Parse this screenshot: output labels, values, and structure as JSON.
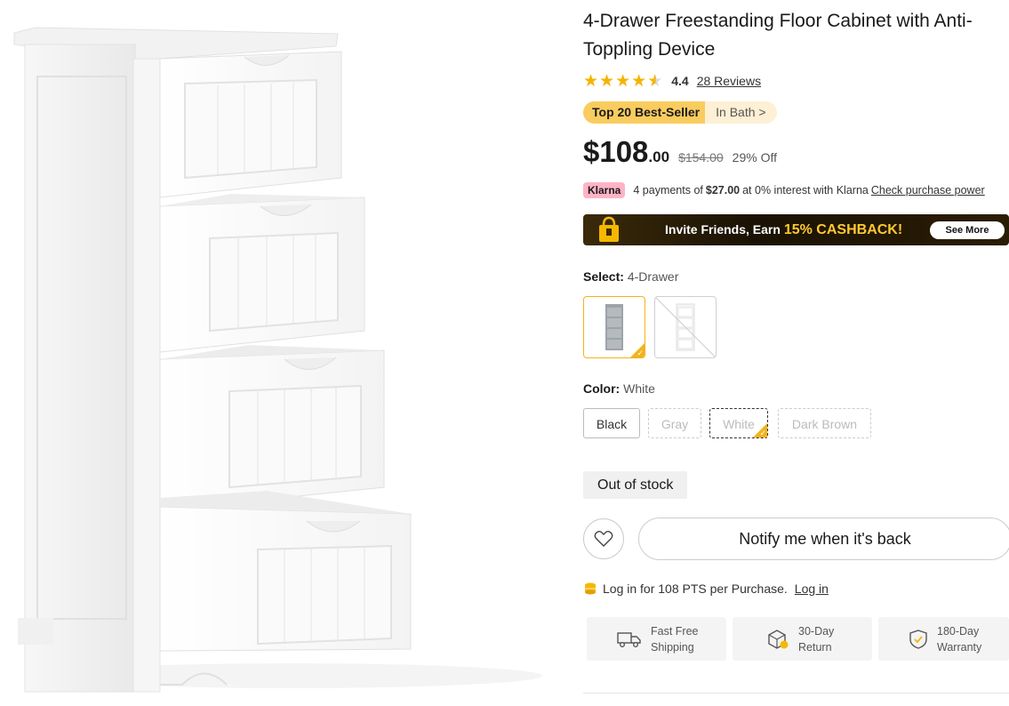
{
  "product": {
    "title": "4-Drawer Freestanding Floor Cabinet with Anti-Toppling Device",
    "image_alt": "White 4-drawer freestanding floor cabinet with open drawers"
  },
  "rating": {
    "value": "4.4",
    "stars": 4.4,
    "reviews": "28 Reviews"
  },
  "badge": {
    "tag": "Top 20 Best-Seller",
    "category": "In Bath >"
  },
  "price": {
    "main": "$108",
    "cents": ".00",
    "original": "$154.00",
    "discount": "29% Off"
  },
  "klarna": {
    "badge": "Klarna",
    "text_before": "4 payments of",
    "amount": "$27.00",
    "text_after": "at 0% interest with Klarna",
    "link": "Check purchase power"
  },
  "banner": {
    "text": "Invite Friends, Earn",
    "highlight": "15% CASHBACK!",
    "button": "See More"
  },
  "select": {
    "label": "Select:",
    "value": "4-Drawer",
    "options": [
      {
        "name": "4-Drawer Gray",
        "selected": true,
        "available": true
      },
      {
        "name": "4-Drawer White",
        "selected": false,
        "available": false
      }
    ]
  },
  "color": {
    "label": "Color:",
    "value": "White",
    "options": [
      {
        "label": "Black",
        "available": true,
        "selected": false
      },
      {
        "label": "Gray",
        "available": false,
        "selected": false
      },
      {
        "label": "White",
        "available": false,
        "selected": true
      },
      {
        "label": "Dark Brown",
        "available": false,
        "selected": false
      }
    ]
  },
  "stock": {
    "status": "Out of stock"
  },
  "actions": {
    "notify": "Notify me when it's back"
  },
  "points": {
    "text": "Log in for 108 PTS per Purchase.",
    "link": "Log in"
  },
  "features": [
    {
      "line1": "Fast Free",
      "line2": "Shipping",
      "icon": "truck-icon"
    },
    {
      "line1": "30-Day",
      "line2": "Return",
      "icon": "return-box-icon"
    },
    {
      "line1": "180-Day",
      "line2": "Warranty",
      "icon": "shield-check-icon"
    }
  ],
  "colors": {
    "accent": "#f2b31b",
    "star": "#f5b400",
    "klarna": "#ffb3c7",
    "badge": "#f9cc5f"
  }
}
